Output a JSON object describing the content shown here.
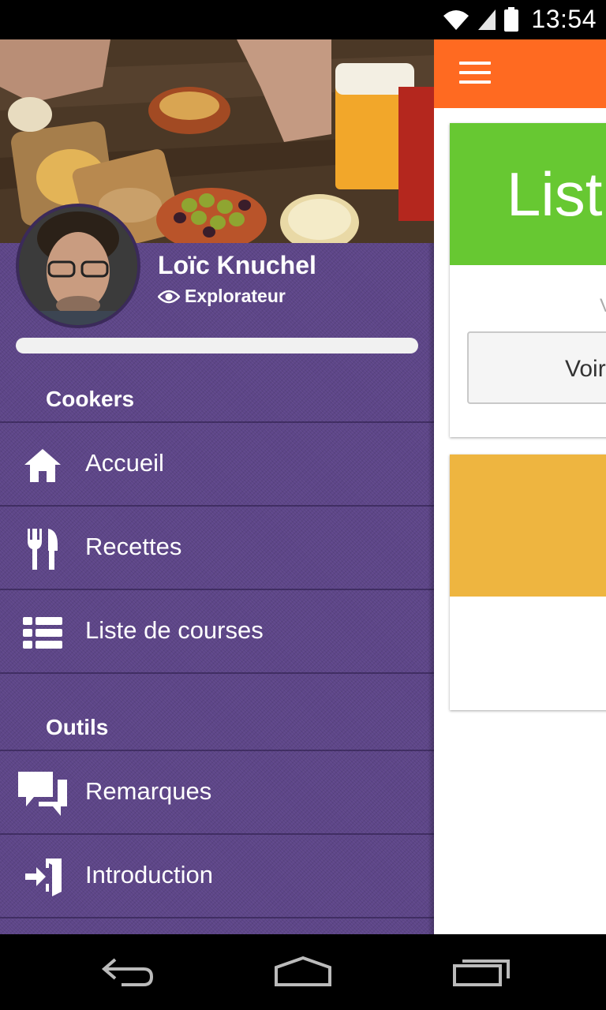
{
  "status_bar": {
    "time": "13:54"
  },
  "app": {
    "card1": {
      "title": "List",
      "subtitle": "V",
      "button_label": "Voir"
    }
  },
  "drawer": {
    "user": {
      "name": "Loïc Knuchel",
      "role": "Explorateur"
    },
    "progress": 1.0,
    "sections": [
      {
        "title": "Cookers"
      },
      {
        "title": "Outils"
      }
    ],
    "items": [
      {
        "label": "Accueil",
        "icon": "home-icon"
      },
      {
        "label": "Recettes",
        "icon": "fork-knife-icon"
      },
      {
        "label": "Liste de courses",
        "icon": "list-icon"
      },
      {
        "label": "Remarques",
        "icon": "comments-icon"
      },
      {
        "label": "Introduction",
        "icon": "sign-in-icon"
      }
    ]
  },
  "colors": {
    "toolbar": "#ff6a21",
    "drawer": "#5d4588",
    "card_green": "#67c832",
    "card_yellow": "#eeb540"
  }
}
